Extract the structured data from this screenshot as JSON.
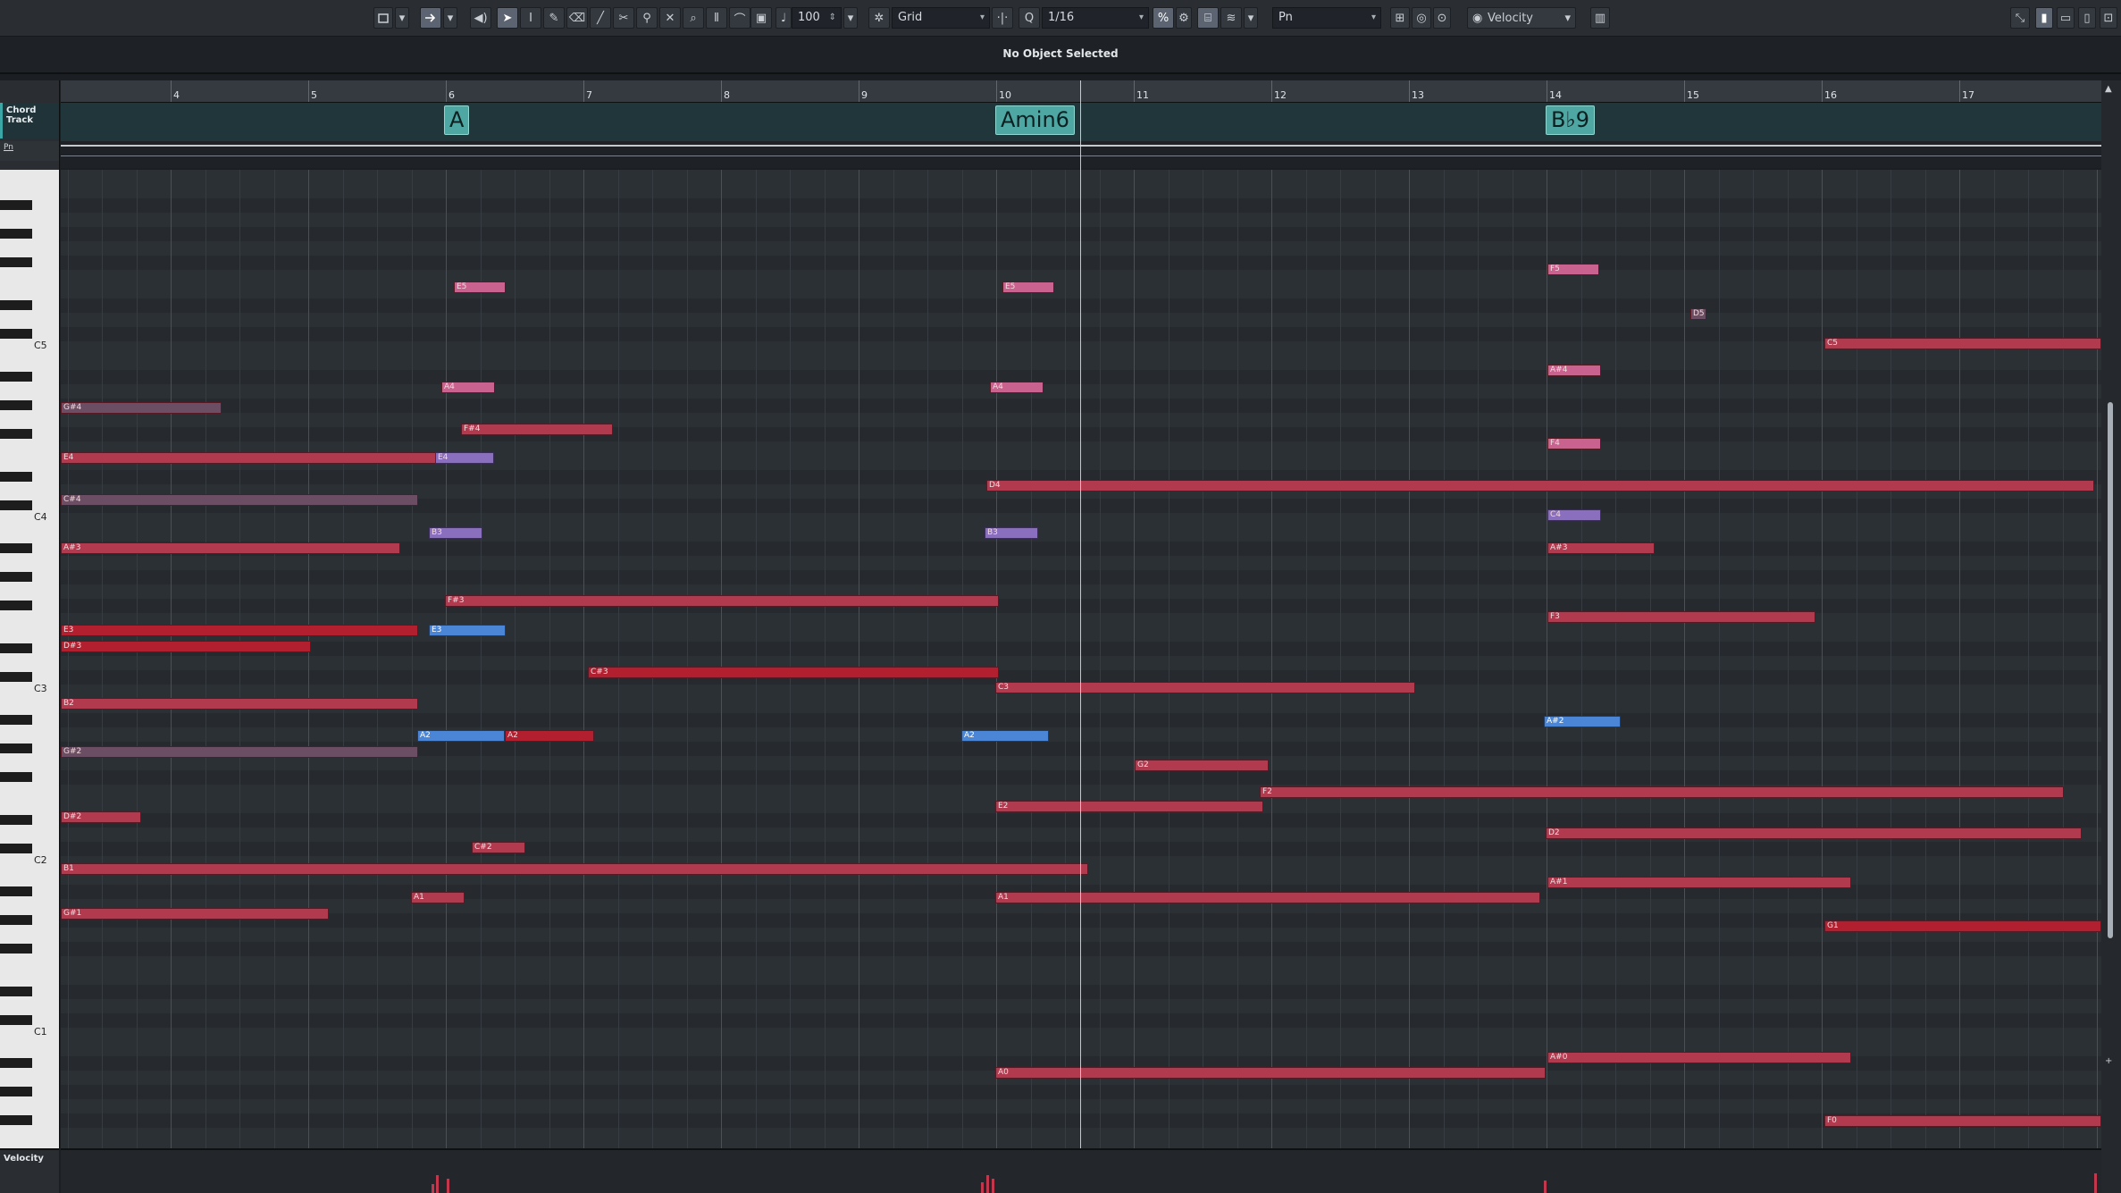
{
  "toolbar": {
    "velocity_value": "100",
    "snap_mode": "Grid",
    "quantize": "1/16",
    "track_name": "Pn",
    "controller_lane": "Velocity"
  },
  "info_line": {
    "status": "No Object Selected"
  },
  "ruler": {
    "bars": [
      "4",
      "5",
      "6",
      "7",
      "8",
      "9",
      "10",
      "11",
      "12",
      "13",
      "14",
      "15",
      "16",
      "17"
    ]
  },
  "track_headers": {
    "chord_track": "Chord Track",
    "instrument": "Pn"
  },
  "chords": [
    "A",
    "Amin6",
    "B♭9"
  ],
  "keyboard": {
    "octave_labels": [
      "C5",
      "C4",
      "C3",
      "C2",
      "C1"
    ]
  },
  "notes": [
    {
      "label": "E5"
    },
    {
      "label": "E5"
    },
    {
      "label": "F5"
    },
    {
      "label": "A4"
    },
    {
      "label": "A4"
    },
    {
      "label": "A#4"
    },
    {
      "label": "F#4"
    },
    {
      "label": "F4"
    },
    {
      "label": "E4"
    },
    {
      "label": "E4"
    },
    {
      "label": "C4"
    },
    {
      "label": "B3"
    },
    {
      "label": "B3"
    },
    {
      "label": "A#3"
    },
    {
      "label": "A#3"
    },
    {
      "label": "F#3"
    },
    {
      "label": "F3"
    },
    {
      "label": "E3"
    },
    {
      "label": "E3"
    },
    {
      "label": "D#3"
    },
    {
      "label": "C#3"
    },
    {
      "label": "C3"
    },
    {
      "label": "B2"
    },
    {
      "label": "A#2"
    },
    {
      "label": "A2"
    },
    {
      "label": "A2"
    },
    {
      "label": "A2"
    },
    {
      "label": "G#2"
    },
    {
      "label": "G2"
    },
    {
      "label": "F2"
    },
    {
      "label": "E2"
    },
    {
      "label": "D#2"
    },
    {
      "label": "D2"
    },
    {
      "label": "C#2"
    },
    {
      "label": "B1"
    },
    {
      "label": "A#1"
    },
    {
      "label": "A1"
    },
    {
      "label": "A1"
    },
    {
      "label": "G#1"
    },
    {
      "label": "G1"
    },
    {
      "label": "A#0"
    },
    {
      "label": "A0"
    },
    {
      "label": "F0"
    },
    {
      "label": "D4"
    },
    {
      "label": "C#4"
    },
    {
      "label": "G#4"
    },
    {
      "label": "C5"
    },
    {
      "label": "D5"
    }
  ],
  "velocity_lane": {
    "label": "Velocity"
  }
}
